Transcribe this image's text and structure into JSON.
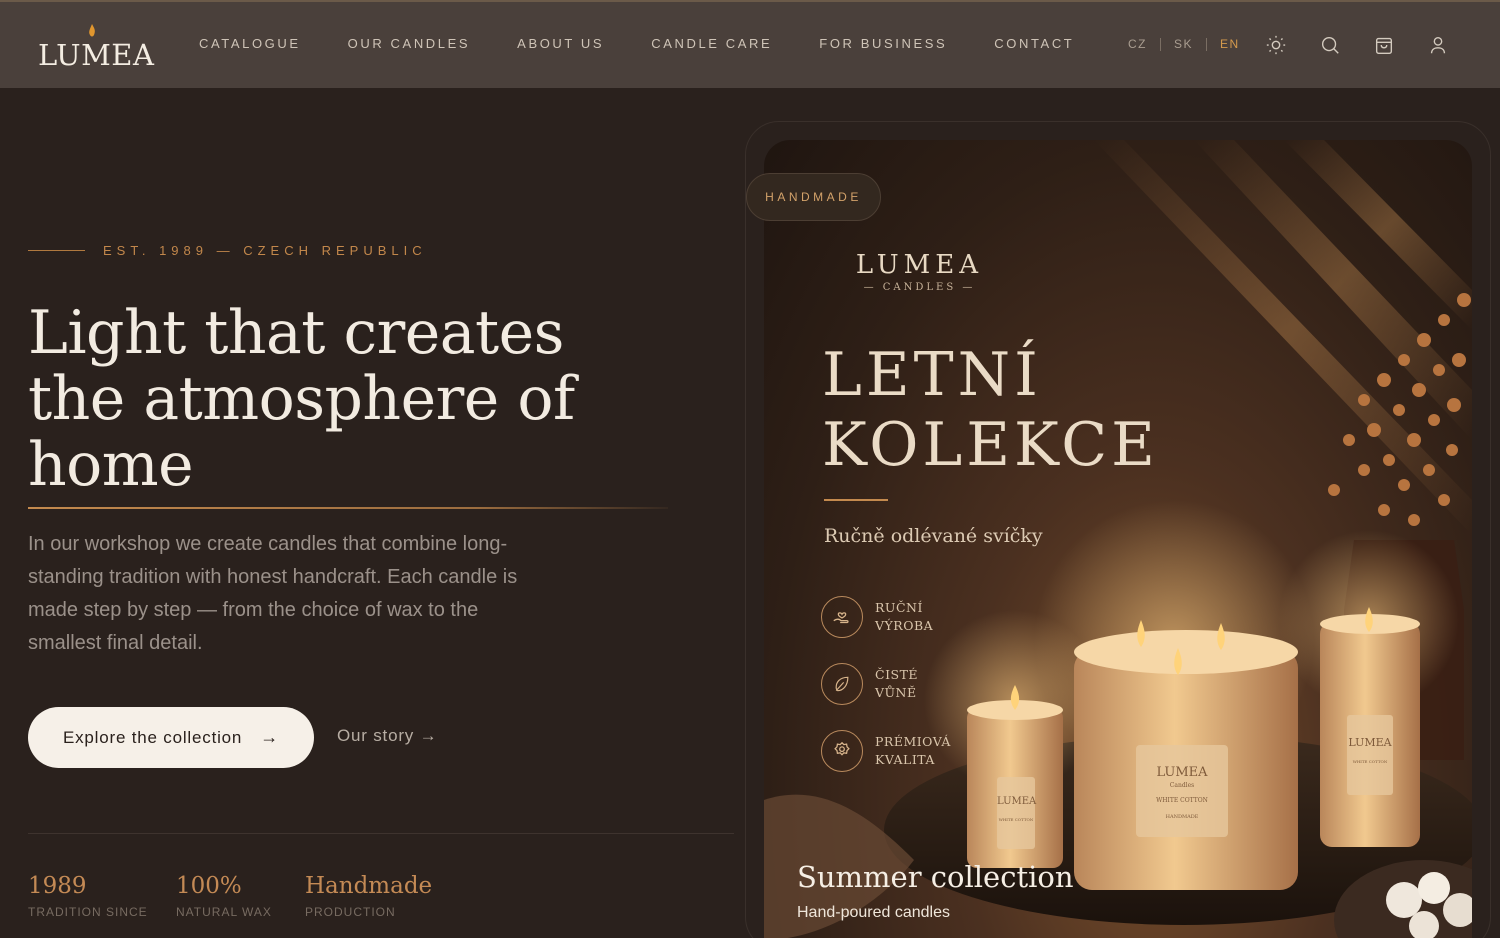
{
  "brand": {
    "name": "LUMEA"
  },
  "nav": {
    "items": [
      "CATALOGUE",
      "OUR CANDLES",
      "ABOUT US",
      "CANDLE CARE",
      "FOR BUSINESS",
      "CONTACT"
    ],
    "languages": [
      "CZ",
      "SK",
      "EN"
    ],
    "active_language": "EN",
    "icons": [
      "sun-icon",
      "search-icon",
      "cart-icon",
      "user-icon"
    ]
  },
  "hero": {
    "eyebrow": "EST. 1989 — CZECH REPUBLIC",
    "title": "Light that creates the atmosphere of home",
    "lead": "In our workshop we create candles that combine long-standing tradition with honest handcraft. Each candle is made step by step — from the choice of wax to the smallest final detail.",
    "cta_primary": "Explore the collection",
    "cta_secondary": "Our story →",
    "stats": [
      {
        "value": "1989",
        "label": "TRADITION SINCE"
      },
      {
        "value": "100%",
        "label": "NATURAL WAX"
      },
      {
        "value": "Handmade",
        "label": "PRODUCTION"
      }
    ]
  },
  "card": {
    "badge": "HANDMADE",
    "logo_word": "LUMEA",
    "logo_sub": "— CANDLES —",
    "headline_1": "LETNÍ",
    "headline_2": "KOLEKCE",
    "subline": "Ručně odlévané svíčky",
    "features": [
      {
        "icon": "hand-heart-icon",
        "line1": "RUČNÍ",
        "line2": "VÝROBA"
      },
      {
        "icon": "leaf-icon",
        "line1": "ČISTÉ",
        "line2": "VŮNĚ"
      },
      {
        "icon": "badge-star-icon",
        "line1": "PRÉMIOVÁ",
        "line2": "KVALITA"
      }
    ],
    "label_title": "LUMEA",
    "label_sub": "Candles",
    "label_scent": "WHITE COTTON",
    "label_made": "HANDMADE",
    "caption_title": "Summer collection",
    "caption_sub": "Hand-poured candles"
  },
  "colors": {
    "bg": "#2a211d",
    "nav": "#4a403b",
    "accent": "#c48a4e",
    "cream": "#f6f0e8"
  }
}
